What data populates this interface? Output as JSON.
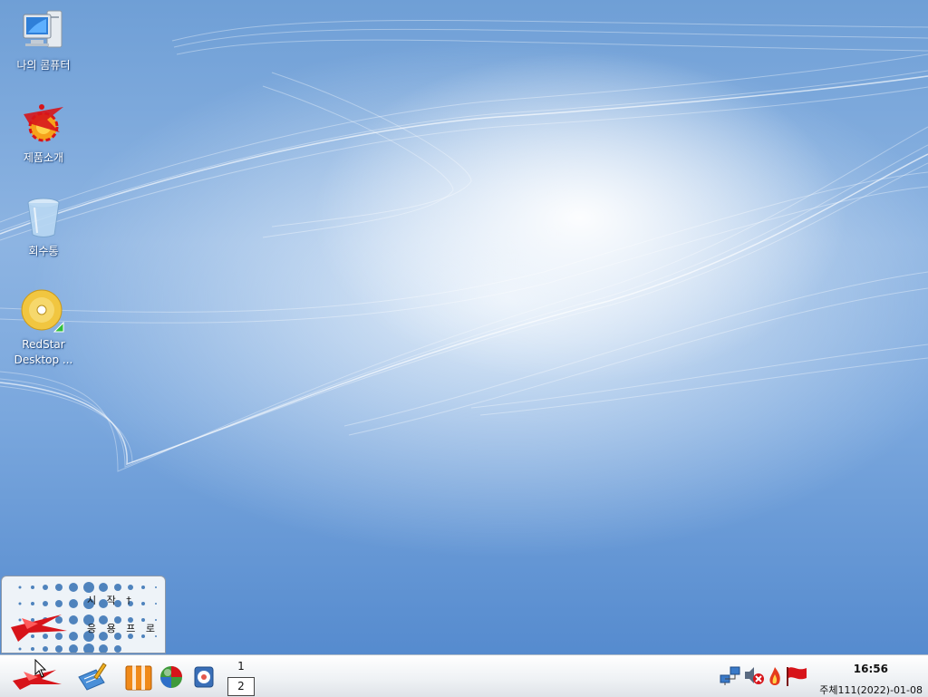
{
  "desktop": {
    "icons": [
      {
        "label": "나의 콤퓨터",
        "icon": "computer-icon"
      },
      {
        "label": "제품소개",
        "icon": "redstar-product-icon"
      },
      {
        "label": "회수통",
        "icon": "trash-icon"
      },
      {
        "label": "RedStar\nDesktop ...",
        "icon": "cd-disc-icon"
      }
    ]
  },
  "start_popup": {
    "line1": "시 작 †",
    "line2": "응 용 프 로"
  },
  "taskbar": {
    "launchers": [
      "start-menu-icon",
      "editor-icon",
      "office-icon",
      "browser-icon",
      "media-icon"
    ],
    "pager": {
      "desktop1": "1",
      "desktop2": "2"
    },
    "tray": [
      "network-icon",
      "volume-muted-icon",
      "fire-icon",
      "red-flag-icon"
    ],
    "clock": "16:56",
    "date": "주체111(2022)-01-08"
  },
  "colors": {
    "wallpaper": "#7aa7dd",
    "taskbar": "#eef1f4",
    "accent_red": "#d7141a"
  }
}
